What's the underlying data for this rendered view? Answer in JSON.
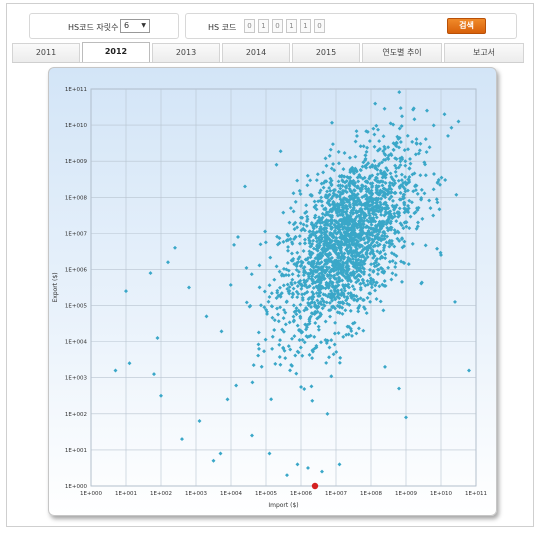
{
  "controls": {
    "digits_label": "HS코드 자릿수",
    "digits_value": "6",
    "code_label": "HS 코드",
    "code_digits": [
      "0",
      "1",
      "0",
      "1",
      "1",
      "0"
    ],
    "search_label": "검색"
  },
  "tabs": [
    {
      "label": "2011",
      "active": false
    },
    {
      "label": "2012",
      "active": true
    },
    {
      "label": "2013",
      "active": false
    },
    {
      "label": "2014",
      "active": false
    },
    {
      "label": "2015",
      "active": false
    },
    {
      "label": "연도별 추이",
      "active": false
    },
    {
      "label": "보고서",
      "active": false
    }
  ],
  "chart_data": {
    "type": "scatter",
    "xlabel": "Import ($)",
    "ylabel": "Export ($)",
    "x_scale": "log",
    "y_scale": "log",
    "xlim_log10": [
      0,
      11
    ],
    "ylim_log10": [
      0,
      11
    ],
    "x_ticks": [
      "1E+000",
      "1E+001",
      "1E+002",
      "1E+003",
      "1E+004",
      "1E+005",
      "1E+006",
      "1E+007",
      "1E+008",
      "1E+009",
      "1E+010",
      "1E+011"
    ],
    "y_ticks": [
      "1E+000",
      "1E+001",
      "1E+002",
      "1E+003",
      "1E+004",
      "1E+005",
      "1E+006",
      "1E+007",
      "1E+008",
      "1E+009",
      "1E+010",
      "1E+011"
    ],
    "grid": true,
    "point_color": "#3aa7c8",
    "highlight_color": "#d42020",
    "highlight_point": {
      "import_log10": 6.4,
      "export_log10": 0
    },
    "cluster": {
      "center_import_log10": 7.3,
      "center_export_log10": 6.8,
      "spread_import_log10": 0.95,
      "spread_export_log10": 1.3,
      "point_count": 2200
    },
    "outliers_log10": [
      [
        0.7,
        3.2
      ],
      [
        1.1,
        3.4
      ],
      [
        1.0,
        5.4
      ],
      [
        1.8,
        3.1
      ],
      [
        2.0,
        2.5
      ],
      [
        1.7,
        5.9
      ],
      [
        2.2,
        6.2
      ],
      [
        2.4,
        6.6
      ],
      [
        1.9,
        4.1
      ],
      [
        2.6,
        1.3
      ],
      [
        2.8,
        5.5
      ],
      [
        3.1,
        1.8
      ],
      [
        3.3,
        4.7
      ],
      [
        3.5,
        0.7
      ],
      [
        3.7,
        0.9
      ],
      [
        3.9,
        2.4
      ],
      [
        4.2,
        6.9
      ],
      [
        4.4,
        8.3
      ],
      [
        4.6,
        1.4
      ],
      [
        4.8,
        3.8
      ],
      [
        5.1,
        0.9
      ],
      [
        5.3,
        8.9
      ],
      [
        5.6,
        0.3
      ],
      [
        9.0,
        1.9
      ],
      [
        9.3,
        9.5
      ],
      [
        9.6,
        10.4
      ],
      [
        10.1,
        10.3
      ],
      [
        10.5,
        10.1
      ],
      [
        10.2,
        9.7
      ],
      [
        10.8,
        3.2
      ],
      [
        10.4,
        5.1
      ],
      [
        10.0,
        6.4
      ],
      [
        9.9,
        8.4
      ],
      [
        9.7,
        7.7
      ],
      [
        8.4,
        3.3
      ],
      [
        8.8,
        2.7
      ],
      [
        6.2,
        0.5
      ],
      [
        6.6,
        0.4
      ],
      [
        7.1,
        0.6
      ],
      [
        5.9,
        0.6
      ]
    ]
  }
}
